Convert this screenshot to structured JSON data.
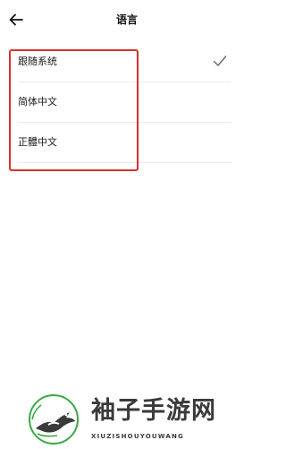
{
  "header": {
    "title": "语言",
    "back_icon": "arrow-left-icon"
  },
  "language_list": {
    "items": [
      {
        "label": "跟随系统",
        "selected": true
      },
      {
        "label": "简体中文",
        "selected": false
      },
      {
        "label": "正體中文",
        "selected": false
      }
    ],
    "check_icon": "checkmark-icon"
  },
  "annotation": {
    "highlight_color": "#d9302b"
  },
  "watermark": {
    "logo_icon": "magpie-logo-icon",
    "text": "袖子手游网",
    "subtext": "XIUZISHOUYOUWANG",
    "accent_color": "#3aa845"
  },
  "colors": {
    "background": "#ffffff",
    "text": "#1a1a1a",
    "divider": "#ececec",
    "check": "#666666"
  }
}
